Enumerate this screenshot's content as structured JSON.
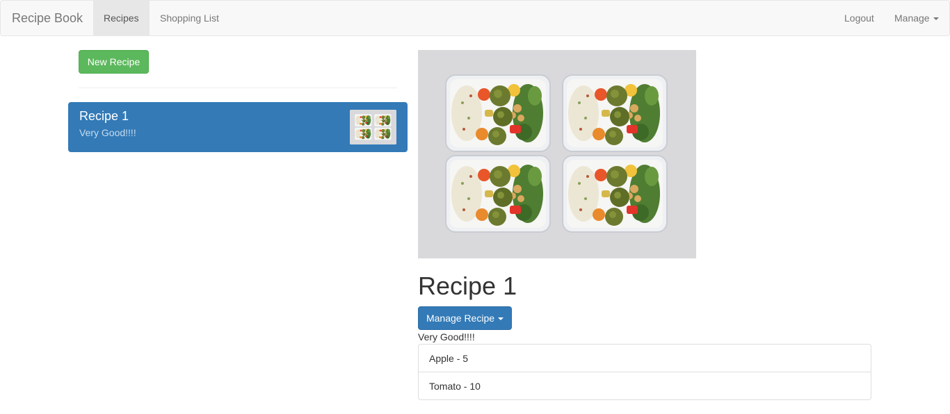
{
  "navbar": {
    "brand": "Recipe Book",
    "links": [
      {
        "label": "Recipes",
        "active": true
      },
      {
        "label": "Shopping List",
        "active": false
      }
    ],
    "right": {
      "logout": "Logout",
      "manage": "Manage"
    }
  },
  "sidebar": {
    "new_recipe_label": "New Recipe",
    "recipes": [
      {
        "name": "Recipe 1",
        "description": "Very Good!!!!",
        "selected": true
      }
    ]
  },
  "detail": {
    "image_icon": "meal-prep-containers-photo",
    "name": "Recipe 1",
    "manage_label": "Manage Recipe",
    "description": "Very Good!!!!",
    "ingredients": [
      {
        "text": "Apple - 5"
      },
      {
        "text": "Tomato - 10"
      }
    ]
  },
  "colors": {
    "primary": "#337ab7",
    "success": "#5cb85c",
    "navbar_bg": "#f8f8f8"
  }
}
